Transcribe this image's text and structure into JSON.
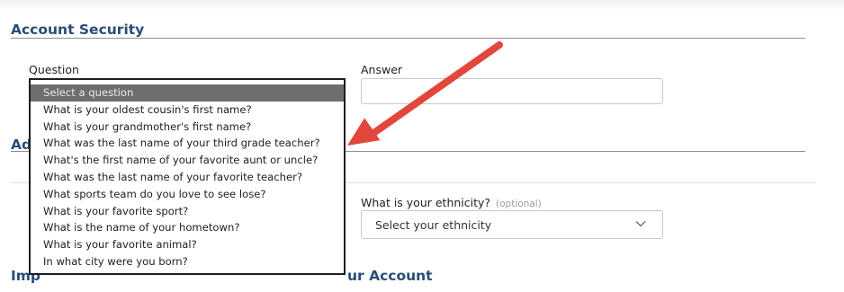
{
  "account_security": {
    "title": "Account Security",
    "question_label": "Question",
    "answer_label": "Answer",
    "answer_value": "",
    "question_dropdown": {
      "selected": "Select a question",
      "options": [
        "Select a question",
        "What is your oldest cousin's first name?",
        "What is your grandmother's first name?",
        "What was the last name of your third grade teacher?",
        "What's the first name of your favorite aunt or uncle?",
        "What was the last name of your favorite teacher?",
        "What sports team do you love to see lose?",
        "What is your favorite sport?",
        "What is the name of your hometown?",
        "What is your favorite animal?",
        "In what city were you born?"
      ]
    }
  },
  "additional_info": {
    "title_visible": "Ad",
    "ethnicity_label": "What is your ethnicity?",
    "ethnicity_optional": "(optional)",
    "ethnicity_selected": "Select your ethnicity"
  },
  "import_section": {
    "title_left": "Imp",
    "title_right": "ur Account"
  },
  "colors": {
    "heading": "#2a4d78",
    "annotation_arrow": "#e2473b",
    "selected_option_bg": "#6e6e6e"
  }
}
